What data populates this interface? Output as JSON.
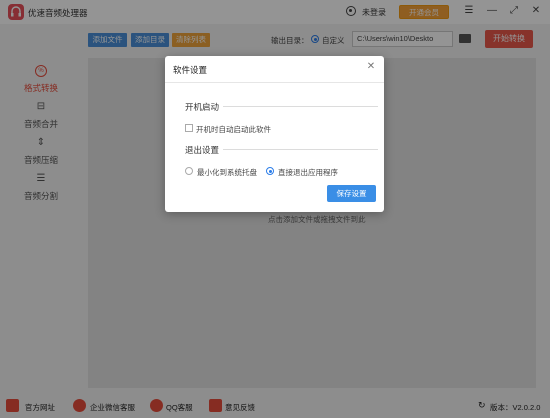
{
  "window": {
    "title": "优速音频处理器",
    "login_label": "未登录",
    "vip_label": "开通会员",
    "menu_icon": "hamburger-icon",
    "minimize_icon": "minimize-icon",
    "maximize_icon": "maximize-icon",
    "close_icon": "close-icon"
  },
  "sidebar": {
    "items": [
      {
        "label": "格式转换",
        "icon": "format-convert-icon",
        "active": true
      },
      {
        "label": "音频合并",
        "icon": "merge-icon",
        "active": false
      },
      {
        "label": "音频压缩",
        "icon": "compress-icon",
        "active": false
      },
      {
        "label": "音频分割",
        "icon": "split-icon",
        "active": false
      }
    ]
  },
  "toolbar": {
    "add_file": "添加文件",
    "add_folder": "添加目录",
    "clear_list": "清除列表",
    "output_label": "输出目录：",
    "custom_label": "自定义",
    "path_value": "C:\\Users\\win10\\Deskto",
    "start_label": "开始转换"
  },
  "work_area": {
    "hint": "点击添加文件或拖拽文件到此"
  },
  "dialog": {
    "title": "软件设置",
    "startup_section": "开机启动",
    "startup_checkbox": "开机时自动启动此软件",
    "exit_section": "退出设置",
    "exit_option_tray": "最小化到系统托盘",
    "exit_option_quit": "直接退出应用程序",
    "save_label": "保存设置"
  },
  "footer": {
    "website": "官方网址",
    "wechat_support": "企业微信客服",
    "qq_support": "QQ客服",
    "feedback": "意见反馈",
    "version": "版本：V2.0.2.0"
  },
  "colors": {
    "accent_red": "#e8584a",
    "accent_blue": "#3a8ee6",
    "vip_orange": "#f7a23a",
    "toolbar_blue": "#4a90d9",
    "toolbar_orange": "#f0a43c"
  }
}
